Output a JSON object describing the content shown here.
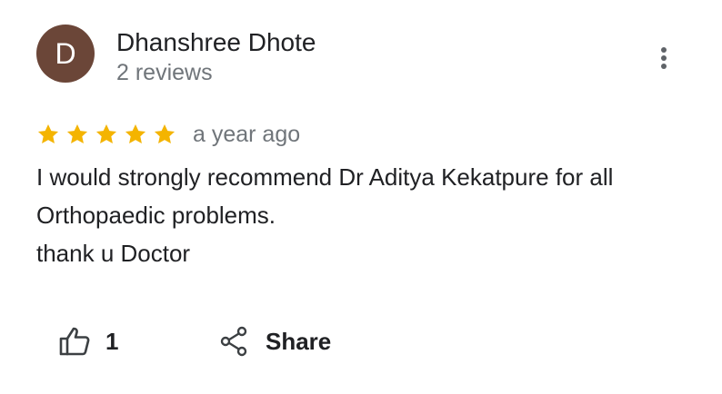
{
  "reviewer": {
    "initial": "D",
    "name": "Dhanshree Dhote",
    "review_count": "2 reviews",
    "avatar_color": "#6b4638"
  },
  "more_menu": {
    "icon": "more-vertical-icon"
  },
  "rating": {
    "stars": 5,
    "max_stars": 5,
    "star_color": "#f4b400",
    "time_ago": "a year ago"
  },
  "review": {
    "lines": [
      "I would strongly recommend Dr Aditya Kekatpure for all",
      "Orthopaedic problems.",
      "thank u Doctor"
    ]
  },
  "actions": {
    "like": {
      "icon": "thumbs-up-icon",
      "count": "1"
    },
    "share": {
      "icon": "share-icon",
      "label": "Share"
    }
  }
}
